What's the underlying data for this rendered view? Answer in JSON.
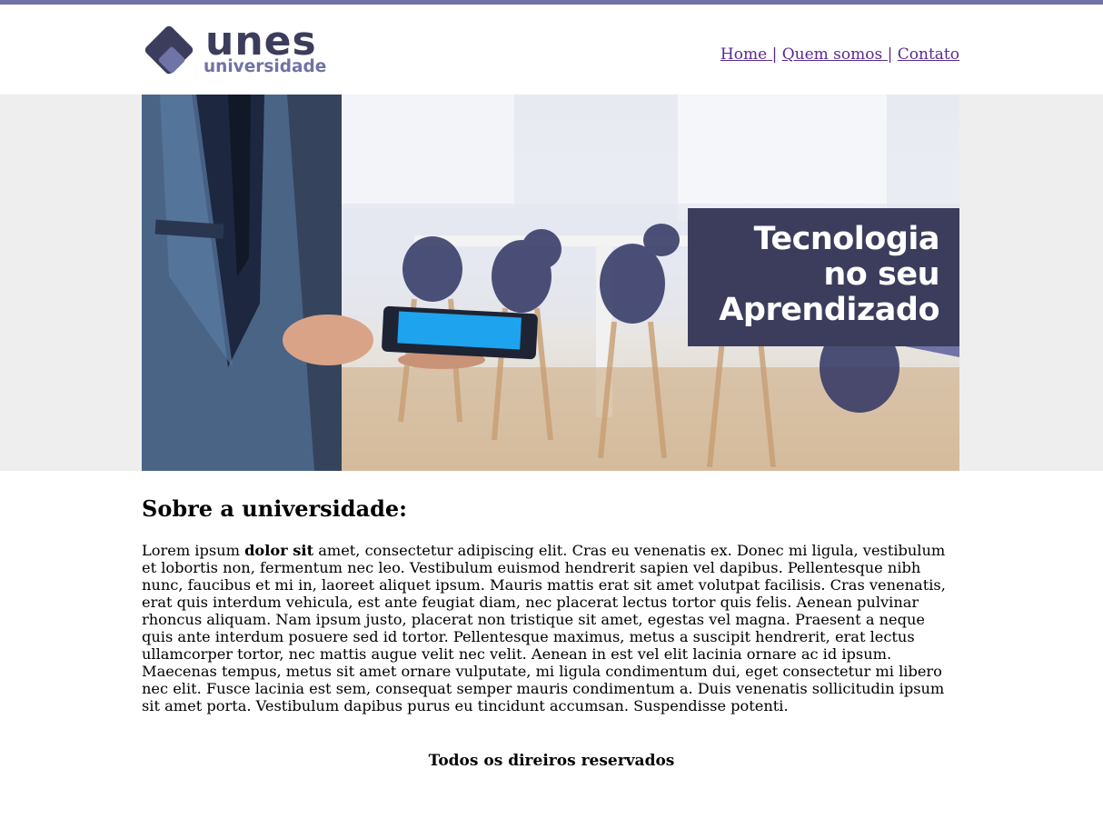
{
  "header": {
    "logo_text": "unes",
    "logo_subtext": "universidade",
    "nav": [
      {
        "label": "Home"
      },
      {
        "label": "Quem somos"
      },
      {
        "label": "Contato"
      }
    ],
    "separator": "|"
  },
  "banner": {
    "caption_lines": [
      "Tecnologia",
      "no seu",
      "Aprendizado"
    ]
  },
  "main": {
    "heading": "Sobre a universidade:",
    "paragraph_lead": "Lorem ipsum ",
    "paragraph_bold": "dolor sit",
    "paragraph_rest": " amet, consectetur adipiscing elit. Cras eu venenatis ex. Donec mi ligula, vestibulum et lobortis non, fermentum nec leo. Vestibulum euismod hendrerit sapien vel dapibus. Pellentesque nibh nunc, faucibus et mi in, laoreet aliquet ipsum. Mauris mattis erat sit amet volutpat facilisis. Cras venenatis, erat quis interdum vehicula, est ante feugiat diam, nec placerat lectus tortor quis felis. Aenean pulvinar rhoncus aliquam. Nam ipsum justo, placerat non tristique sit amet, egestas vel magna. Praesent a neque quis ante interdum posuere sed id tortor. Pellentesque maximus, metus a suscipit hendrerit, erat lectus ullamcorper tortor, nec mattis augue velit nec velit. Aenean in est vel elit lacinia ornare ac id ipsum. Maecenas tempus, metus sit amet ornare vulputate, mi ligula condimentum dui, eget consectetur mi libero nec elit. Fusce lacinia est sem, consequat semper mauris condimentum a. Duis venenatis sollicitudin ipsum sit amet porta. Vestibulum dapibus purus eu tincidunt accumsan. Suspendisse potenti."
  },
  "footer": {
    "text": "Todos os direiros reservados"
  },
  "colors": {
    "brand_dark": "#3c3d5c",
    "brand_light": "#6f73a6",
    "link": "#5b2a8c"
  }
}
